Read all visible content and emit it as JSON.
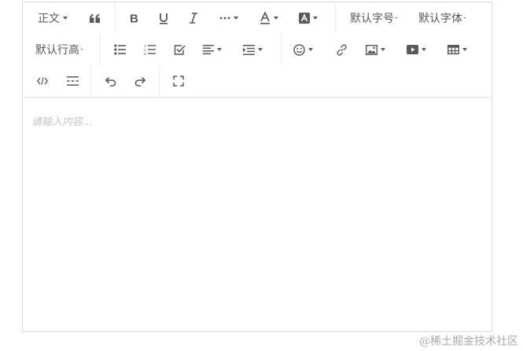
{
  "toolbar": {
    "heading": "正文",
    "font_size": "默认字号",
    "font_family": "默认字体",
    "line_height": "默认行高"
  },
  "editor": {
    "placeholder": "请输入内容..."
  },
  "watermark": "@稀土掘金技术社区",
  "colors": {
    "icon": "#595959",
    "border": "#d9d9d9",
    "placeholder": "#c4c4c4"
  }
}
